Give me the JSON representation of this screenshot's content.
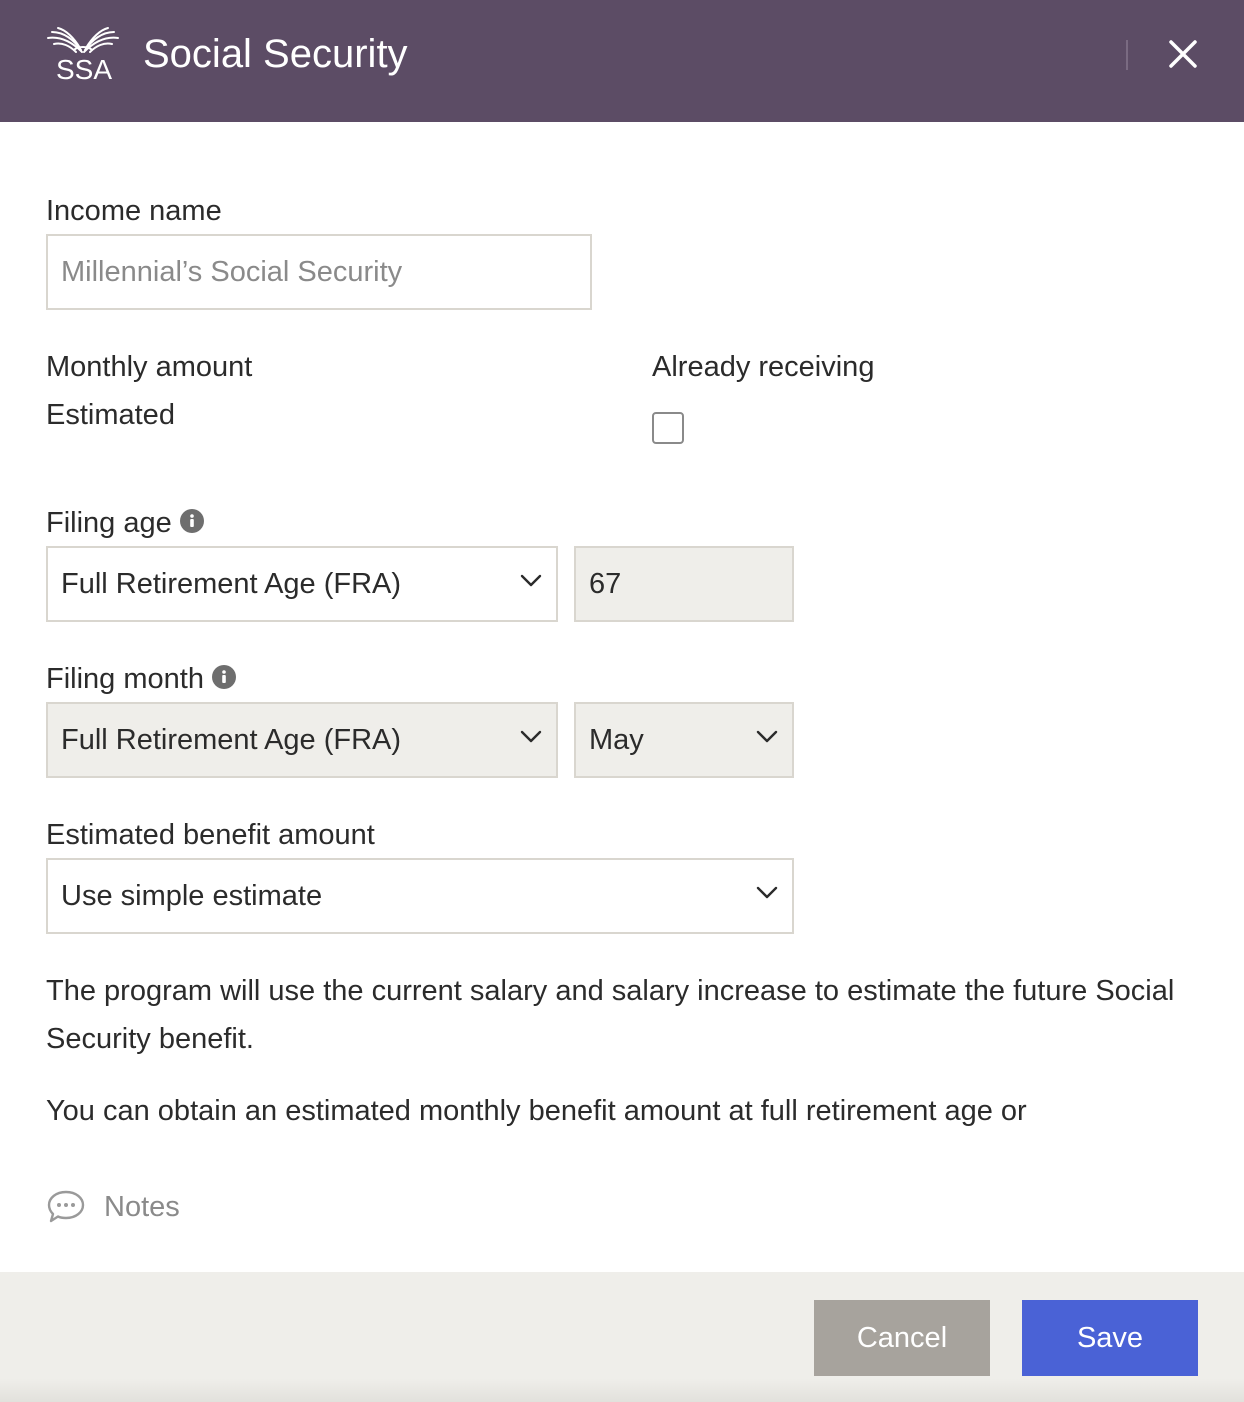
{
  "header": {
    "logo_text": "SSA",
    "title": "Social Security",
    "close_icon": "close-icon",
    "background": "#5c4c65"
  },
  "form": {
    "income_name": {
      "label": "Income name",
      "placeholder": "Millennial’s Social Security"
    },
    "monthly_amount": {
      "label": "Monthly amount",
      "value": "Estimated"
    },
    "already_receiving": {
      "label": "Already receiving",
      "checked": false
    },
    "filing_age": {
      "label": "Filing age",
      "selected": "Full Retirement Age (FRA)",
      "age_value": "67"
    },
    "filing_month": {
      "label": "Filing month",
      "selected": "Full Retirement Age (FRA)",
      "month_value": "May"
    },
    "estimated_benefit": {
      "label": "Estimated benefit amount",
      "selected": "Use simple estimate"
    },
    "description_1": "The program will use the current salary and salary increase to estimate the future Social Security benefit.",
    "description_2": "You can obtain an estimated monthly benefit amount at full retirement age or",
    "notes_label": "Notes"
  },
  "footer": {
    "cancel_label": "Cancel",
    "save_label": "Save",
    "save_color": "#4a62d6",
    "cancel_color": "#a7a39d"
  }
}
